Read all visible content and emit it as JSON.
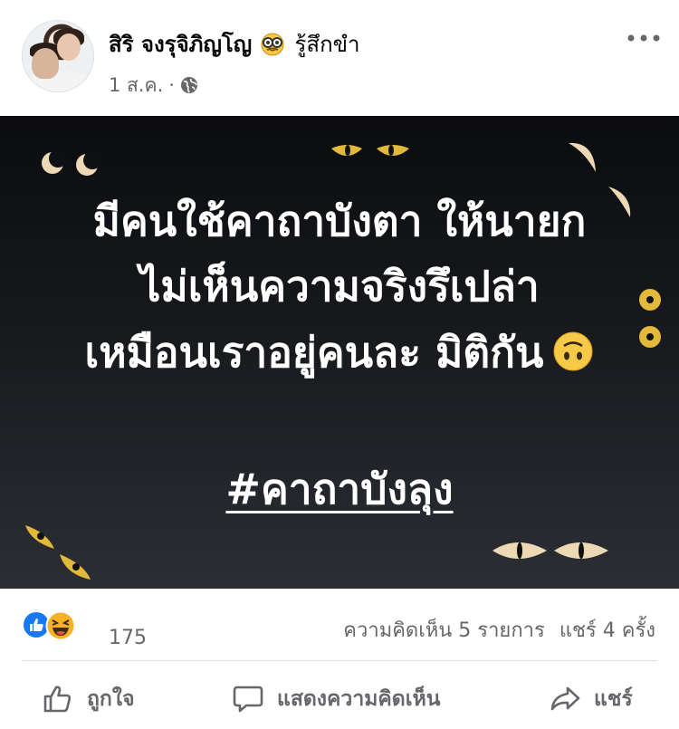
{
  "post": {
    "author_name": "สิริ จงรุจิภิญโญ",
    "feeling_text": "รู้สึกขำ",
    "feeling_icon": "nerd-glasses-emoji-icon",
    "date": "1 ส.ค.",
    "separator": "·",
    "privacy_icon": "globe-icon",
    "more_icon": "more-options-icon"
  },
  "image": {
    "lines": [
      "มีคนใช้คาถาบังตา ให้นายก",
      "ไม่เห็นความจริงรึเปล่า",
      "เหมือนเราอยู่คนละ มิติกัน"
    ],
    "line3_emoji": "upside-down-face-emoji-icon",
    "hashtag": "#คาถาบังลุง",
    "background": "#15171a",
    "eye_color": "#ecd9b4"
  },
  "stats": {
    "reaction_icons": [
      "like-reaction-icon",
      "haha-reaction-icon"
    ],
    "reaction_count": "175",
    "comments": "ความคิดเห็น 5 รายการ",
    "shares": "แชร์ 4 ครั้ง"
  },
  "actions": {
    "like_label": "ถูกใจ",
    "comment_label": "แสดงความคิดเห็น",
    "share_label": "แชร์"
  },
  "colors": {
    "secondary_text": "#65676b",
    "like_blue": "#1877f2",
    "haha_yellow": "#f7b125",
    "divider": "#dadde1"
  }
}
